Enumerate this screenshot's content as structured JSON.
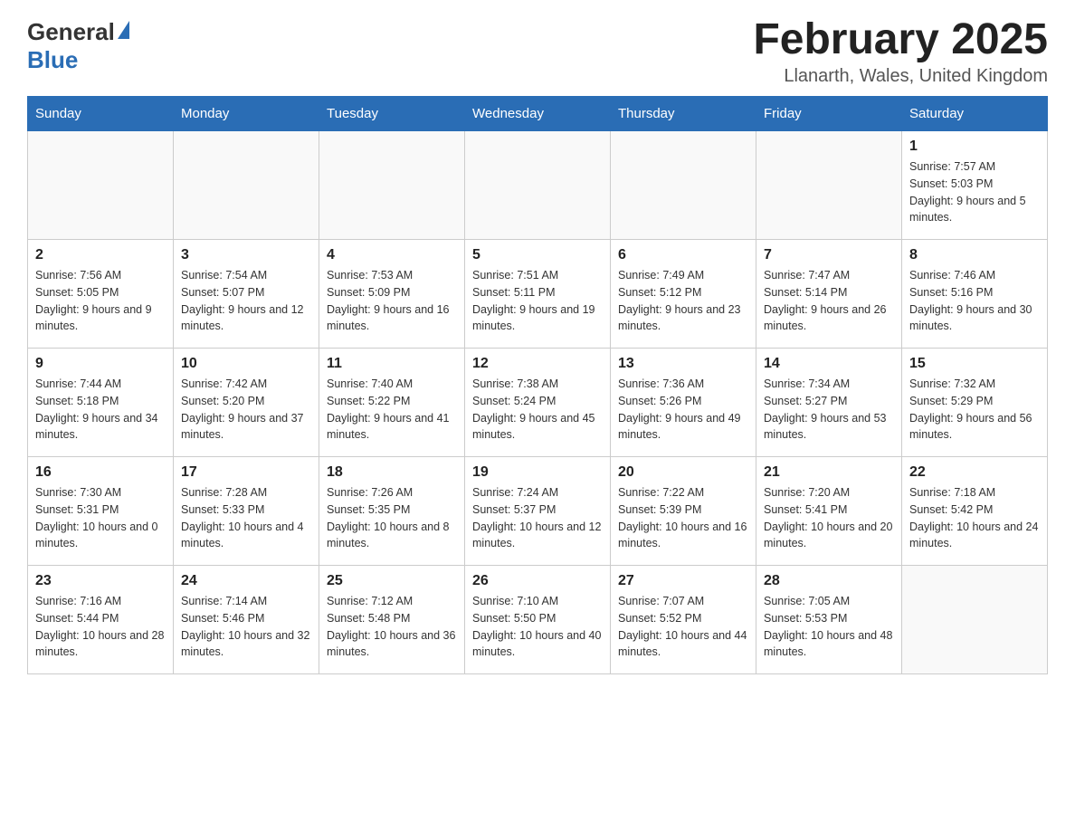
{
  "logo": {
    "text_general": "General",
    "text_blue": "Blue"
  },
  "title": {
    "month_year": "February 2025",
    "location": "Llanarth, Wales, United Kingdom"
  },
  "weekdays": [
    "Sunday",
    "Monday",
    "Tuesday",
    "Wednesday",
    "Thursday",
    "Friday",
    "Saturday"
  ],
  "weeks": [
    [
      {
        "day": "",
        "sunrise": "",
        "sunset": "",
        "daylight": ""
      },
      {
        "day": "",
        "sunrise": "",
        "sunset": "",
        "daylight": ""
      },
      {
        "day": "",
        "sunrise": "",
        "sunset": "",
        "daylight": ""
      },
      {
        "day": "",
        "sunrise": "",
        "sunset": "",
        "daylight": ""
      },
      {
        "day": "",
        "sunrise": "",
        "sunset": "",
        "daylight": ""
      },
      {
        "day": "",
        "sunrise": "",
        "sunset": "",
        "daylight": ""
      },
      {
        "day": "1",
        "sunrise": "Sunrise: 7:57 AM",
        "sunset": "Sunset: 5:03 PM",
        "daylight": "Daylight: 9 hours and 5 minutes."
      }
    ],
    [
      {
        "day": "2",
        "sunrise": "Sunrise: 7:56 AM",
        "sunset": "Sunset: 5:05 PM",
        "daylight": "Daylight: 9 hours and 9 minutes."
      },
      {
        "day": "3",
        "sunrise": "Sunrise: 7:54 AM",
        "sunset": "Sunset: 5:07 PM",
        "daylight": "Daylight: 9 hours and 12 minutes."
      },
      {
        "day": "4",
        "sunrise": "Sunrise: 7:53 AM",
        "sunset": "Sunset: 5:09 PM",
        "daylight": "Daylight: 9 hours and 16 minutes."
      },
      {
        "day": "5",
        "sunrise": "Sunrise: 7:51 AM",
        "sunset": "Sunset: 5:11 PM",
        "daylight": "Daylight: 9 hours and 19 minutes."
      },
      {
        "day": "6",
        "sunrise": "Sunrise: 7:49 AM",
        "sunset": "Sunset: 5:12 PM",
        "daylight": "Daylight: 9 hours and 23 minutes."
      },
      {
        "day": "7",
        "sunrise": "Sunrise: 7:47 AM",
        "sunset": "Sunset: 5:14 PM",
        "daylight": "Daylight: 9 hours and 26 minutes."
      },
      {
        "day": "8",
        "sunrise": "Sunrise: 7:46 AM",
        "sunset": "Sunset: 5:16 PM",
        "daylight": "Daylight: 9 hours and 30 minutes."
      }
    ],
    [
      {
        "day": "9",
        "sunrise": "Sunrise: 7:44 AM",
        "sunset": "Sunset: 5:18 PM",
        "daylight": "Daylight: 9 hours and 34 minutes."
      },
      {
        "day": "10",
        "sunrise": "Sunrise: 7:42 AM",
        "sunset": "Sunset: 5:20 PM",
        "daylight": "Daylight: 9 hours and 37 minutes."
      },
      {
        "day": "11",
        "sunrise": "Sunrise: 7:40 AM",
        "sunset": "Sunset: 5:22 PM",
        "daylight": "Daylight: 9 hours and 41 minutes."
      },
      {
        "day": "12",
        "sunrise": "Sunrise: 7:38 AM",
        "sunset": "Sunset: 5:24 PM",
        "daylight": "Daylight: 9 hours and 45 minutes."
      },
      {
        "day": "13",
        "sunrise": "Sunrise: 7:36 AM",
        "sunset": "Sunset: 5:26 PM",
        "daylight": "Daylight: 9 hours and 49 minutes."
      },
      {
        "day": "14",
        "sunrise": "Sunrise: 7:34 AM",
        "sunset": "Sunset: 5:27 PM",
        "daylight": "Daylight: 9 hours and 53 minutes."
      },
      {
        "day": "15",
        "sunrise": "Sunrise: 7:32 AM",
        "sunset": "Sunset: 5:29 PM",
        "daylight": "Daylight: 9 hours and 56 minutes."
      }
    ],
    [
      {
        "day": "16",
        "sunrise": "Sunrise: 7:30 AM",
        "sunset": "Sunset: 5:31 PM",
        "daylight": "Daylight: 10 hours and 0 minutes."
      },
      {
        "day": "17",
        "sunrise": "Sunrise: 7:28 AM",
        "sunset": "Sunset: 5:33 PM",
        "daylight": "Daylight: 10 hours and 4 minutes."
      },
      {
        "day": "18",
        "sunrise": "Sunrise: 7:26 AM",
        "sunset": "Sunset: 5:35 PM",
        "daylight": "Daylight: 10 hours and 8 minutes."
      },
      {
        "day": "19",
        "sunrise": "Sunrise: 7:24 AM",
        "sunset": "Sunset: 5:37 PM",
        "daylight": "Daylight: 10 hours and 12 minutes."
      },
      {
        "day": "20",
        "sunrise": "Sunrise: 7:22 AM",
        "sunset": "Sunset: 5:39 PM",
        "daylight": "Daylight: 10 hours and 16 minutes."
      },
      {
        "day": "21",
        "sunrise": "Sunrise: 7:20 AM",
        "sunset": "Sunset: 5:41 PM",
        "daylight": "Daylight: 10 hours and 20 minutes."
      },
      {
        "day": "22",
        "sunrise": "Sunrise: 7:18 AM",
        "sunset": "Sunset: 5:42 PM",
        "daylight": "Daylight: 10 hours and 24 minutes."
      }
    ],
    [
      {
        "day": "23",
        "sunrise": "Sunrise: 7:16 AM",
        "sunset": "Sunset: 5:44 PM",
        "daylight": "Daylight: 10 hours and 28 minutes."
      },
      {
        "day": "24",
        "sunrise": "Sunrise: 7:14 AM",
        "sunset": "Sunset: 5:46 PM",
        "daylight": "Daylight: 10 hours and 32 minutes."
      },
      {
        "day": "25",
        "sunrise": "Sunrise: 7:12 AM",
        "sunset": "Sunset: 5:48 PM",
        "daylight": "Daylight: 10 hours and 36 minutes."
      },
      {
        "day": "26",
        "sunrise": "Sunrise: 7:10 AM",
        "sunset": "Sunset: 5:50 PM",
        "daylight": "Daylight: 10 hours and 40 minutes."
      },
      {
        "day": "27",
        "sunrise": "Sunrise: 7:07 AM",
        "sunset": "Sunset: 5:52 PM",
        "daylight": "Daylight: 10 hours and 44 minutes."
      },
      {
        "day": "28",
        "sunrise": "Sunrise: 7:05 AM",
        "sunset": "Sunset: 5:53 PM",
        "daylight": "Daylight: 10 hours and 48 minutes."
      },
      {
        "day": "",
        "sunrise": "",
        "sunset": "",
        "daylight": ""
      }
    ]
  ]
}
